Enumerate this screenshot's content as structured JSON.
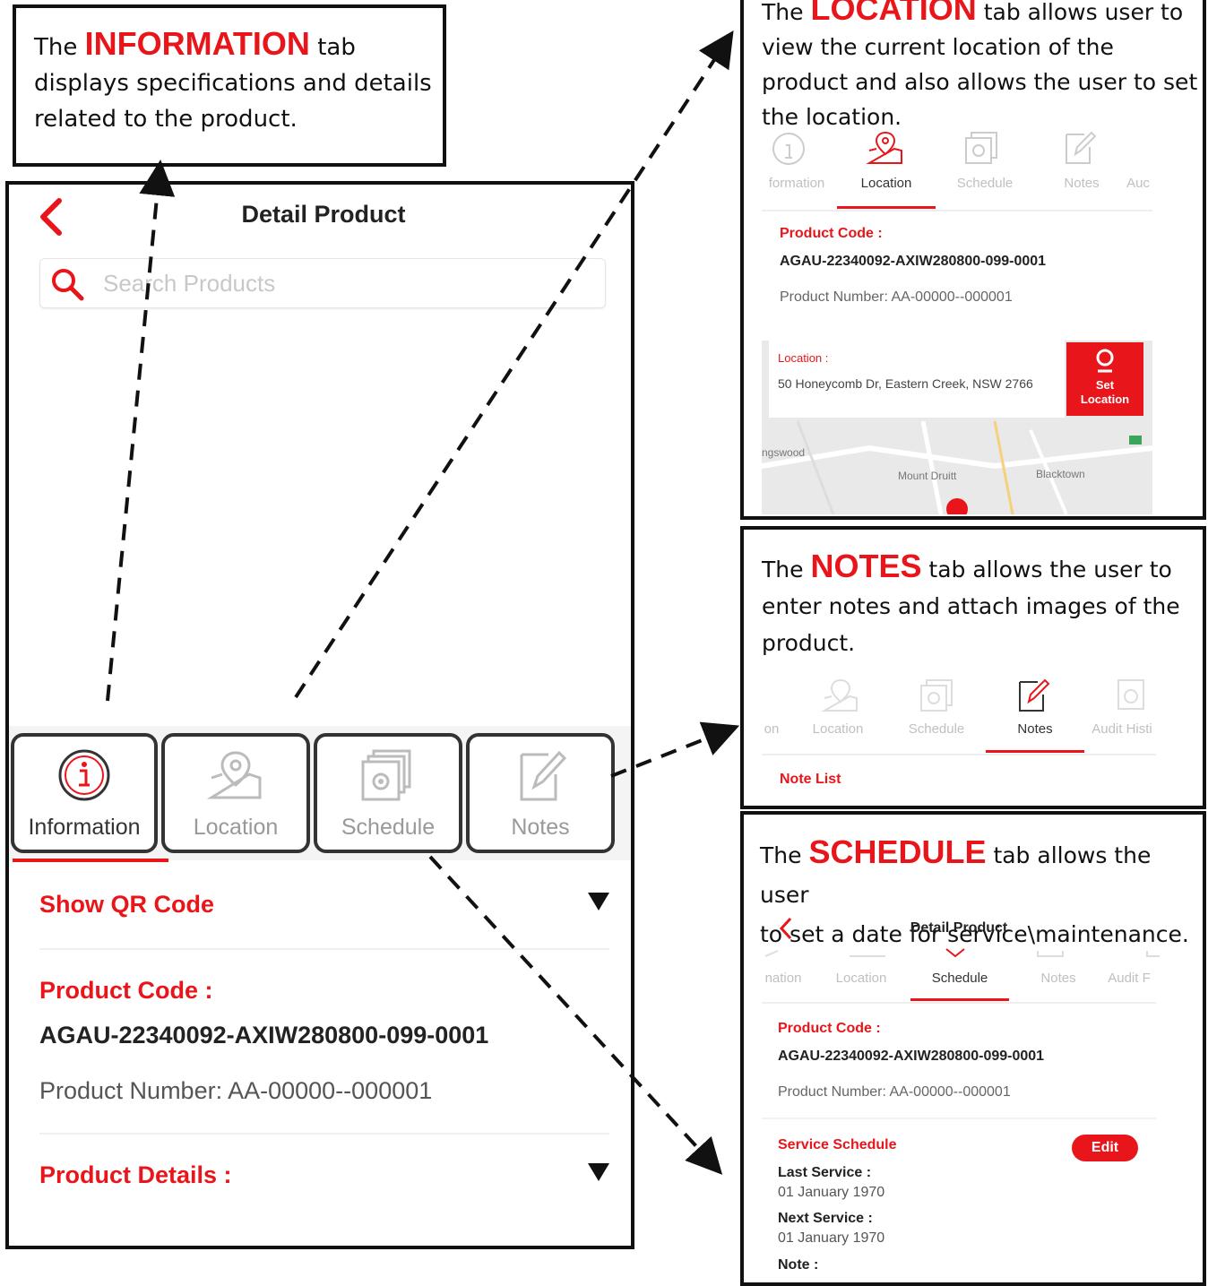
{
  "info_caption": {
    "pre": "The",
    "highlight": "INFORMATION",
    "post1": "tab",
    "line2": "displays specifications and details",
    "line3": "related to the product."
  },
  "location_caption": {
    "pre": "The",
    "highlight": "LOCATION",
    "post1": "tab allows user to",
    "line2": "view the current location of the",
    "line3": "product and also allows the user to set",
    "line4": "the location."
  },
  "notes_caption": {
    "pre": "The",
    "highlight": "NOTES",
    "post1": "tab allows the user to",
    "line2": "enter notes and attach images of the",
    "line3": "product."
  },
  "schedule_caption": {
    "pre": "The",
    "highlight": "SCHEDULE",
    "post1": "tab allows the user",
    "line2": "to set a date for service\\maintenance."
  },
  "phone": {
    "title": "Detail Product",
    "search_placeholder": "Search Products",
    "tabs": [
      "Information",
      "Location",
      "Schedule",
      "Notes"
    ],
    "show_qr": "Show QR Code",
    "product_code_label": "Product Code :",
    "product_code": "AGAU-22340092-AXIW280800-099-0001",
    "product_number": "Product Number: AA-00000--000001",
    "product_details": "Product Details :"
  },
  "location_screen": {
    "tabs": [
      "formation",
      "Location",
      "Schedule",
      "Notes",
      "Auc"
    ],
    "product_code_label": "Product Code :",
    "product_code": "AGAU-22340092-AXIW280800-099-0001",
    "product_number": "Product Number: AA-00000--000001",
    "location_label": "Location :",
    "address": "50 Honeycomb Dr, Eastern Creek, NSW 2766",
    "set_location_1": "Set",
    "set_location_2": "Location",
    "map_labels": [
      "ngswood",
      "Mount Druitt",
      "Blacktown"
    ]
  },
  "notes_screen": {
    "tabs": [
      "on",
      "Location",
      "Schedule",
      "Notes",
      "Audit Histi"
    ],
    "note_list": "Note List"
  },
  "schedule_screen": {
    "title": "Detail Product",
    "tabs": [
      "nation",
      "Location",
      "Schedule",
      "Notes",
      "Audit F"
    ],
    "product_code_label": "Product Code :",
    "product_code": "AGAU-22340092-AXIW280800-099-0001",
    "product_number": "Product Number: AA-00000--000001",
    "service_schedule": "Service Schedule",
    "edit": "Edit",
    "last_service_label": "Last Service :",
    "last_service": "01 January 1970",
    "next_service_label": "Next Service :",
    "next_service": "01 January 1970",
    "note_label": "Note :"
  },
  "colors": {
    "accent": "#e8161b",
    "border": "#111111"
  }
}
